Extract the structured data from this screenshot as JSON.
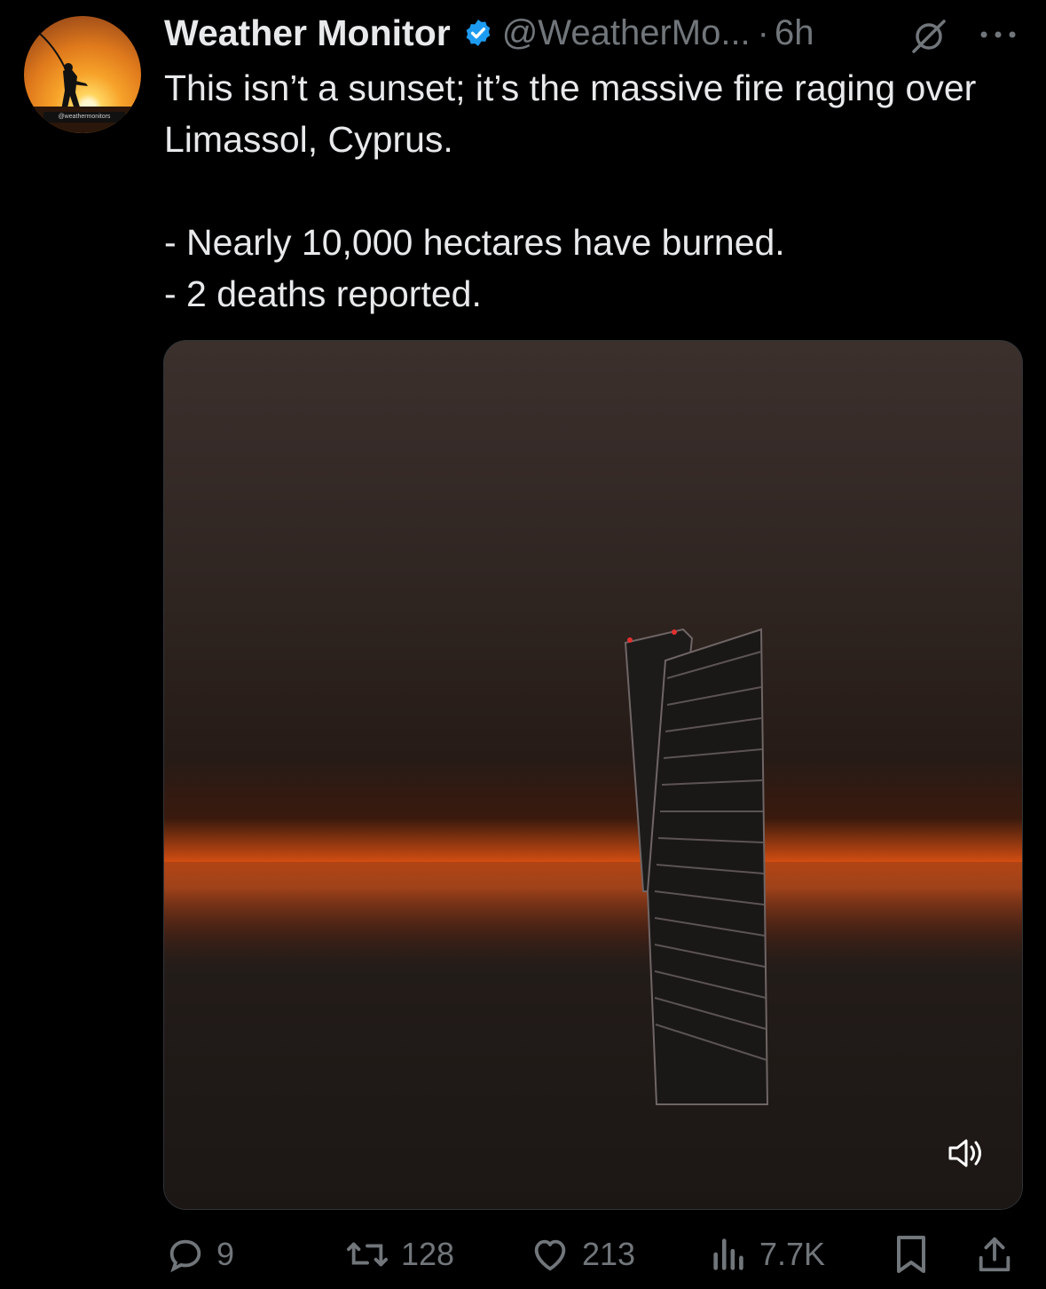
{
  "author": {
    "name": "Weather Monitor",
    "handle": "@WeatherMo...",
    "separator": "·",
    "time": "6h",
    "avatar_tag": "@weathermonitors"
  },
  "tweet": {
    "line1": "This isn’t a sunset; it’s the massive fire raging over Limassol, Cyprus.",
    "line2": "- Nearly 10,000 hectares have burned.",
    "line3": "- 2 deaths reported."
  },
  "actions": {
    "replies": "9",
    "reposts": "128",
    "likes": "213",
    "views": "7.7K"
  },
  "icons": {
    "verified": "verified-badge-icon",
    "grok": "grok-icon",
    "more": "more-icon",
    "sound": "speaker-icon",
    "reply": "reply-icon",
    "repost": "repost-icon",
    "like": "heart-icon",
    "views": "views-icon",
    "bookmark": "bookmark-icon",
    "share": "share-icon"
  },
  "colors": {
    "background": "#000000",
    "text": "#e7e9ea",
    "muted": "#71767b",
    "verified": "#1d9bf0",
    "fire": "#e8581a"
  }
}
